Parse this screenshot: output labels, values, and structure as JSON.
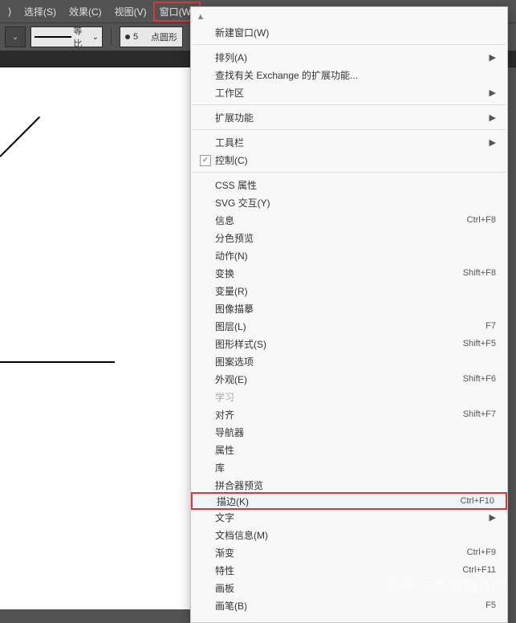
{
  "menubar": {
    "items": [
      {
        "label": ")"
      },
      {
        "label": "选择(S)"
      },
      {
        "label": "效果(C)"
      },
      {
        "label": "视图(V)"
      },
      {
        "label": "窗口(W)",
        "highlighted": true
      }
    ]
  },
  "toolbar": {
    "stroke_ratio_label": "等比",
    "point_value": "5",
    "point_label": "点圆形"
  },
  "dropdown": {
    "groups": [
      [
        {
          "label": "新建窗口(W)"
        }
      ],
      [
        {
          "label": "排列(A)",
          "submenu": true
        },
        {
          "label": "查找有关 Exchange 的扩展功能..."
        },
        {
          "label": "工作区",
          "submenu": true
        }
      ],
      [
        {
          "label": "扩展功能",
          "submenu": true
        }
      ],
      [
        {
          "label": "工具栏",
          "submenu": true
        },
        {
          "label": "控制(C)",
          "checkbox": true,
          "checked": true
        }
      ],
      [
        {
          "label": "CSS 属性"
        },
        {
          "label": "SVG 交互(Y)"
        },
        {
          "label": "信息",
          "shortcut": "Ctrl+F8"
        },
        {
          "label": "分色预览"
        },
        {
          "label": "动作(N)"
        },
        {
          "label": "变换",
          "shortcut": "Shift+F8"
        },
        {
          "label": "变量(R)"
        },
        {
          "label": "图像描摹"
        },
        {
          "label": "图层(L)",
          "shortcut": "F7"
        },
        {
          "label": "图形样式(S)",
          "shortcut": "Shift+F5"
        },
        {
          "label": "图案选项"
        },
        {
          "label": "外观(E)",
          "shortcut": "Shift+F6"
        },
        {
          "label": "学习",
          "disabled": true
        },
        {
          "label": "对齐",
          "shortcut": "Shift+F7"
        },
        {
          "label": "导航器"
        },
        {
          "label": "属性"
        },
        {
          "label": "库"
        },
        {
          "label": "拼合器预览"
        },
        {
          "label": "描边(K)",
          "shortcut": "Ctrl+F10",
          "highlighted": true
        },
        {
          "label": "文字",
          "submenu": true
        },
        {
          "label": "文档信息(M)"
        },
        {
          "label": "渐变",
          "shortcut": "Ctrl+F9"
        },
        {
          "label": "特性",
          "shortcut": "Ctrl+F11"
        },
        {
          "label": "画板"
        },
        {
          "label": "画笔(B)",
          "shortcut": "F5"
        }
      ]
    ]
  },
  "watermark": "知乎 @AI基础入门"
}
